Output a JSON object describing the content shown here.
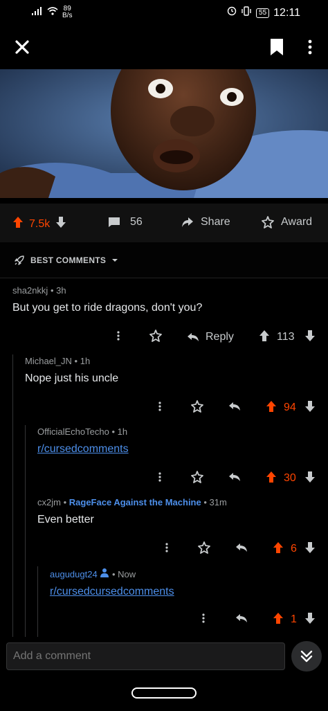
{
  "status_bar": {
    "net_speed_value": "89",
    "net_speed_unit": "B/s",
    "battery": "55",
    "time": "12:11"
  },
  "post": {
    "upvotes": "7.5k",
    "comments": "56",
    "share_label": "Share",
    "award_label": "Award"
  },
  "sort": {
    "label": "BEST COMMENTS"
  },
  "comments": [
    {
      "author": "sha2nkkj",
      "sep": "•",
      "age": "3h",
      "body": "But you get to ride dragons,  don't you?",
      "reply_label": "Reply",
      "score": "113"
    },
    {
      "author": "Michael_JN",
      "sep": "•",
      "age": "1h",
      "body": "Nope just his uncle",
      "score": "94"
    },
    {
      "author": "OfficialEchoTecho",
      "sep": "•",
      "age": "1h",
      "link": "r/cursedcomments",
      "score": "30"
    },
    {
      "author": "cx2jm",
      "sep": "•",
      "flair": "RageFace Against the Machine",
      "sep2": "•",
      "age": "31m",
      "body": "Even better",
      "score": "6"
    },
    {
      "author": "augudugt24",
      "sep": "•",
      "age": "Now",
      "link": "r/cursedcursedcomments",
      "score": "1"
    }
  ],
  "comment_input": {
    "placeholder": "Add a comment"
  },
  "colors": {
    "upvote": "#ff4500",
    "link": "#4d8fea",
    "background": "#000000"
  }
}
